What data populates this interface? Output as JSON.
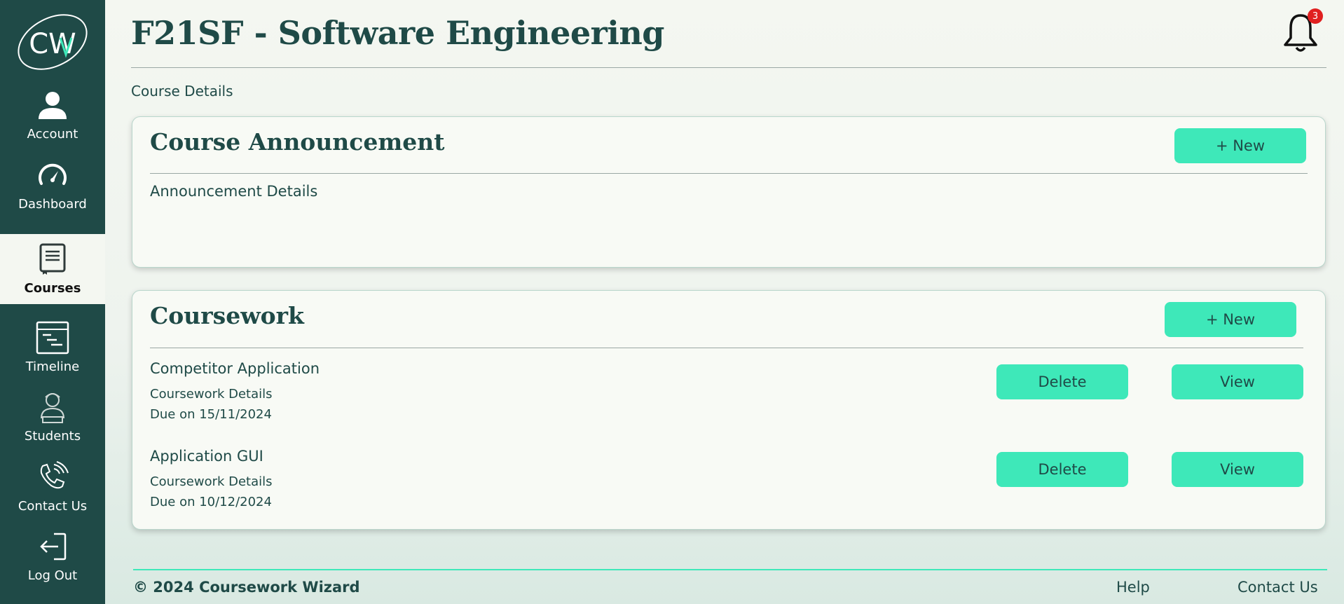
{
  "app": {
    "logo_text": "CW"
  },
  "sidebar": {
    "items": [
      {
        "label": "Account",
        "icon": "user-icon"
      },
      {
        "label": "Dashboard",
        "icon": "gauge-icon"
      },
      {
        "label": "Courses",
        "icon": "book-icon",
        "active": true
      },
      {
        "label": "Timeline",
        "icon": "timeline-icon"
      },
      {
        "label": "Students",
        "icon": "student-icon"
      },
      {
        "label": "Contact Us",
        "icon": "phone-icon"
      },
      {
        "label": "Log Out",
        "icon": "logout-icon"
      }
    ]
  },
  "header": {
    "title": "F21SF - Software Engineering",
    "notifications_count": "3"
  },
  "breadcrumb": "Course Details",
  "announcement": {
    "title": "Course Announcement",
    "new_label": "+ New",
    "details": "Announcement Details"
  },
  "coursework": {
    "title": "Coursework",
    "new_label": "+ New",
    "items": [
      {
        "name": "Competitor Application",
        "details": "Coursework Details",
        "due": "Due on 15/11/2024",
        "delete_label": "Delete",
        "view_label": "View"
      },
      {
        "name": "Application GUI",
        "details": "Coursework Details",
        "due": "Due on 10/12/2024",
        "delete_label": "Delete",
        "view_label": "View"
      }
    ]
  },
  "footer": {
    "copyright": "© 2024 Coursework Wizard",
    "help_label": "Help",
    "contact_label": "Contact Us"
  },
  "colors": {
    "sidebar": "#1f4a47",
    "accent": "#3ee8b9",
    "badge": "#e02020",
    "background": "#f4f7f1"
  }
}
